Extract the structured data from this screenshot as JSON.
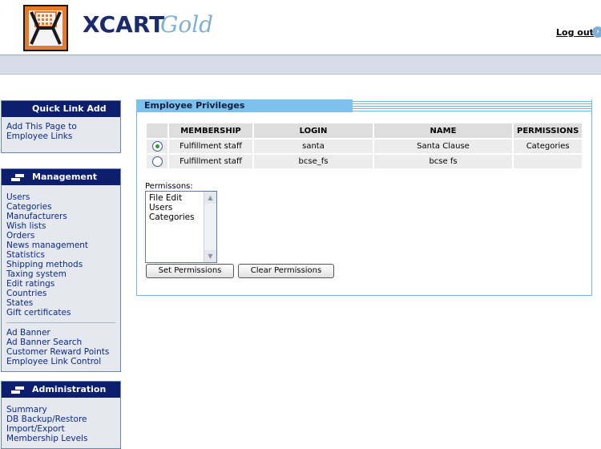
{
  "header": {
    "brand_text": "XCART",
    "brand_sub": "Gold",
    "logout_label": "Log out",
    "logout_icon": "arrow-right-icon"
  },
  "colors": {
    "navy": "#0e1e6e",
    "panel_blue": "#7cc1ee",
    "band": "#d7dde6",
    "logo_orange": "#e8792a"
  },
  "sidebar": {
    "quick_link": {
      "title": "Quick Link Add",
      "links": [
        "Add This Page to",
        "Employee Links"
      ]
    },
    "management": {
      "title": "Management",
      "links": [
        "Users",
        "Categories",
        "Manufacturers",
        "Wish lists",
        "Orders",
        "News management",
        "Statistics",
        "Shipping methods",
        "Taxing system",
        "Edit ratings",
        "Countries",
        "States",
        "Gift certificates"
      ],
      "extra_links": [
        "Ad Banner",
        "Ad Banner Search",
        "Customer Reward Points",
        "Employee Link Control"
      ]
    },
    "administration": {
      "title": "Administration",
      "links": [
        "Summary",
        "DB Backup/Restore",
        "Import/Export",
        "Membership Levels"
      ]
    }
  },
  "panel": {
    "title": "Employee Privileges",
    "table": {
      "headers": [
        "MEMBERSHIP",
        "LOGIN",
        "NAME",
        "PERMISSIONS"
      ],
      "rows": [
        {
          "selected": true,
          "membership": "Fulfillment staff",
          "login": "santa",
          "name": "Santa Clause",
          "permissions": "Categories"
        },
        {
          "selected": false,
          "membership": "Fulfillment staff",
          "login": "bcse_fs",
          "name": "bcse fs",
          "permissions": ""
        }
      ]
    },
    "permissions_label": "Permissons:",
    "permissions_options": [
      "File Edit",
      "Users",
      "Categories"
    ],
    "set_button": "Set Permissions",
    "clear_button": "Clear Permissions"
  }
}
